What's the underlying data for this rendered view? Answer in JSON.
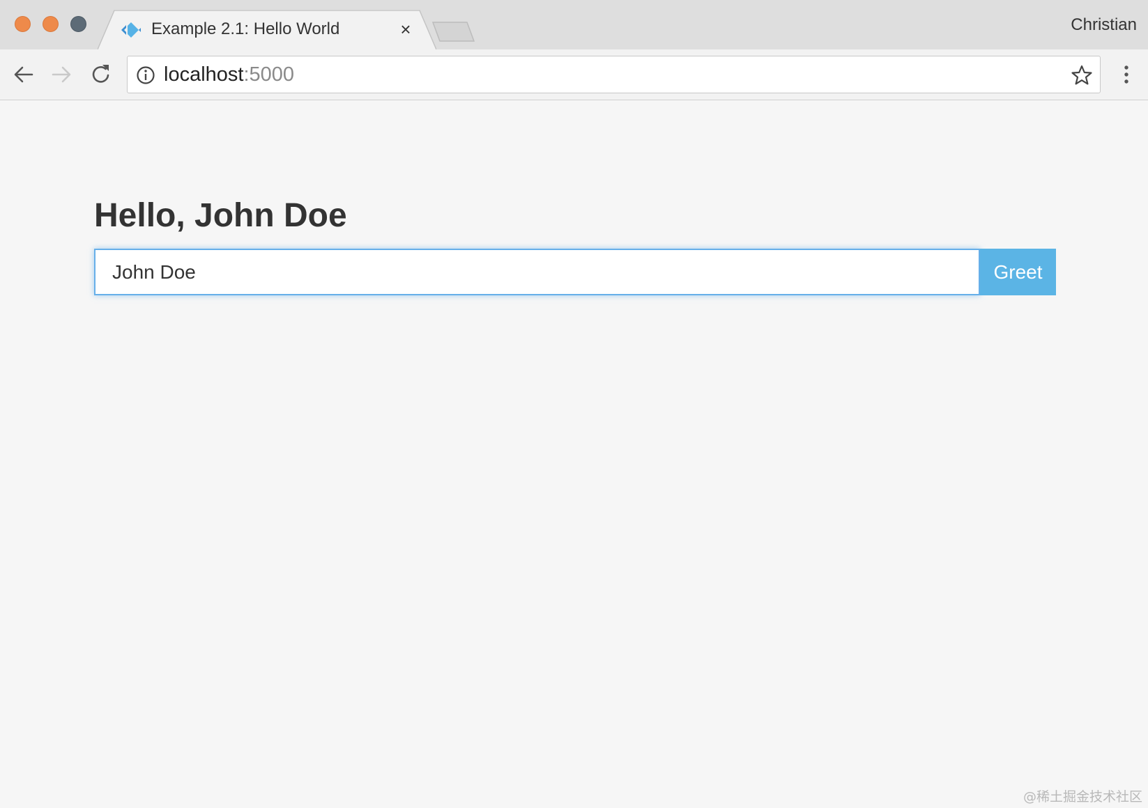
{
  "browser": {
    "tab": {
      "title": "Example 2.1: Hello World",
      "close_label": "×",
      "favicon": "blue-diamond-favicon"
    },
    "profile_name": "Christian",
    "address_bar": {
      "host": "localhost",
      "port": ":5000"
    },
    "icons": {
      "back": "arrow-left-icon",
      "forward": "arrow-right-icon",
      "reload": "reload-icon",
      "site_info": "info-icon",
      "bookmark": "star-icon",
      "menu": "kebab-menu-icon"
    }
  },
  "page": {
    "greeting": "Hello, John Doe",
    "name_input_value": "John Doe",
    "greet_button_label": "Greet",
    "watermark": "@稀土掘金技术社区"
  },
  "colors": {
    "accent": "#5bb4e5",
    "input_focus_border": "#66afe9",
    "traffic_close": "#ee8a4a",
    "traffic_min": "#ee8a4a",
    "traffic_max": "#5d6b77"
  }
}
